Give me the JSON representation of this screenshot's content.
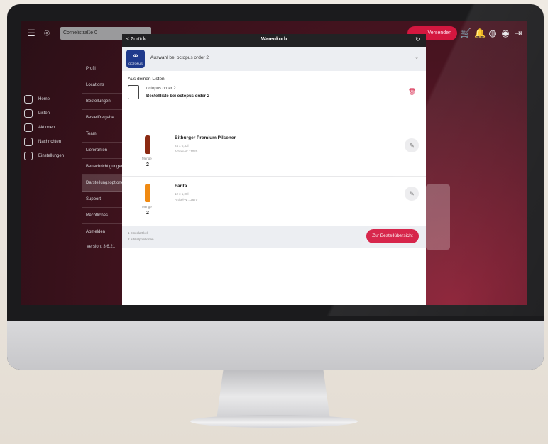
{
  "topbar": {
    "location_value": "Cornelistraße 0",
    "red_pill_label": "Versenden"
  },
  "nav": {
    "items": [
      {
        "label": "Home",
        "icon": "home-icon"
      },
      {
        "label": "Listen",
        "icon": "list-icon"
      },
      {
        "label": "Aktionen",
        "icon": "tag-icon"
      },
      {
        "label": "Nachrichten",
        "icon": "message-icon"
      },
      {
        "label": "Einstellungen",
        "icon": "gear-icon"
      }
    ]
  },
  "submenu": {
    "items": [
      "Profil",
      "Locations",
      "Bestellungen",
      "Bestellfreigabe",
      "Team",
      "Lieferanten",
      "Benachrichtigungen",
      "Darstellungsoptionen",
      "Support",
      "Rechtliches",
      "Abmelden"
    ],
    "version": "Version: 3.6.21"
  },
  "modal": {
    "back_label": "< Zurück",
    "title": "Warenkorb",
    "selector_label": "Auswahl bei octopus order 2",
    "logo_text": "OCTOPUS",
    "section_title": "Aus deinen Listen:",
    "list_name": "octopus order 2",
    "list_sub": "Bestellliste bei octopus order 2",
    "products": [
      {
        "name": "Bitburger Premium Pilsener",
        "meta1": "24 x 0,33l",
        "meta2": "Artikel-Nr.: 1020",
        "menge_label": "Menge",
        "menge": "2",
        "bottle_color": "#8b2a12"
      },
      {
        "name": "Fanta",
        "meta1": "12 x 1,00l",
        "meta2": "Artikel-Nr.: 2670",
        "menge_label": "Menge",
        "menge": "2",
        "bottle_color": "#f08a12"
      }
    ],
    "footer_line1": "1 Einzelartikel",
    "footer_line2": "2 Artikelpositionen",
    "cta_label": "Zur Bestellübersicht"
  },
  "colors": {
    "accent": "#d4173f",
    "screen_bg": "#4a1421",
    "modal_header": "#222224"
  }
}
